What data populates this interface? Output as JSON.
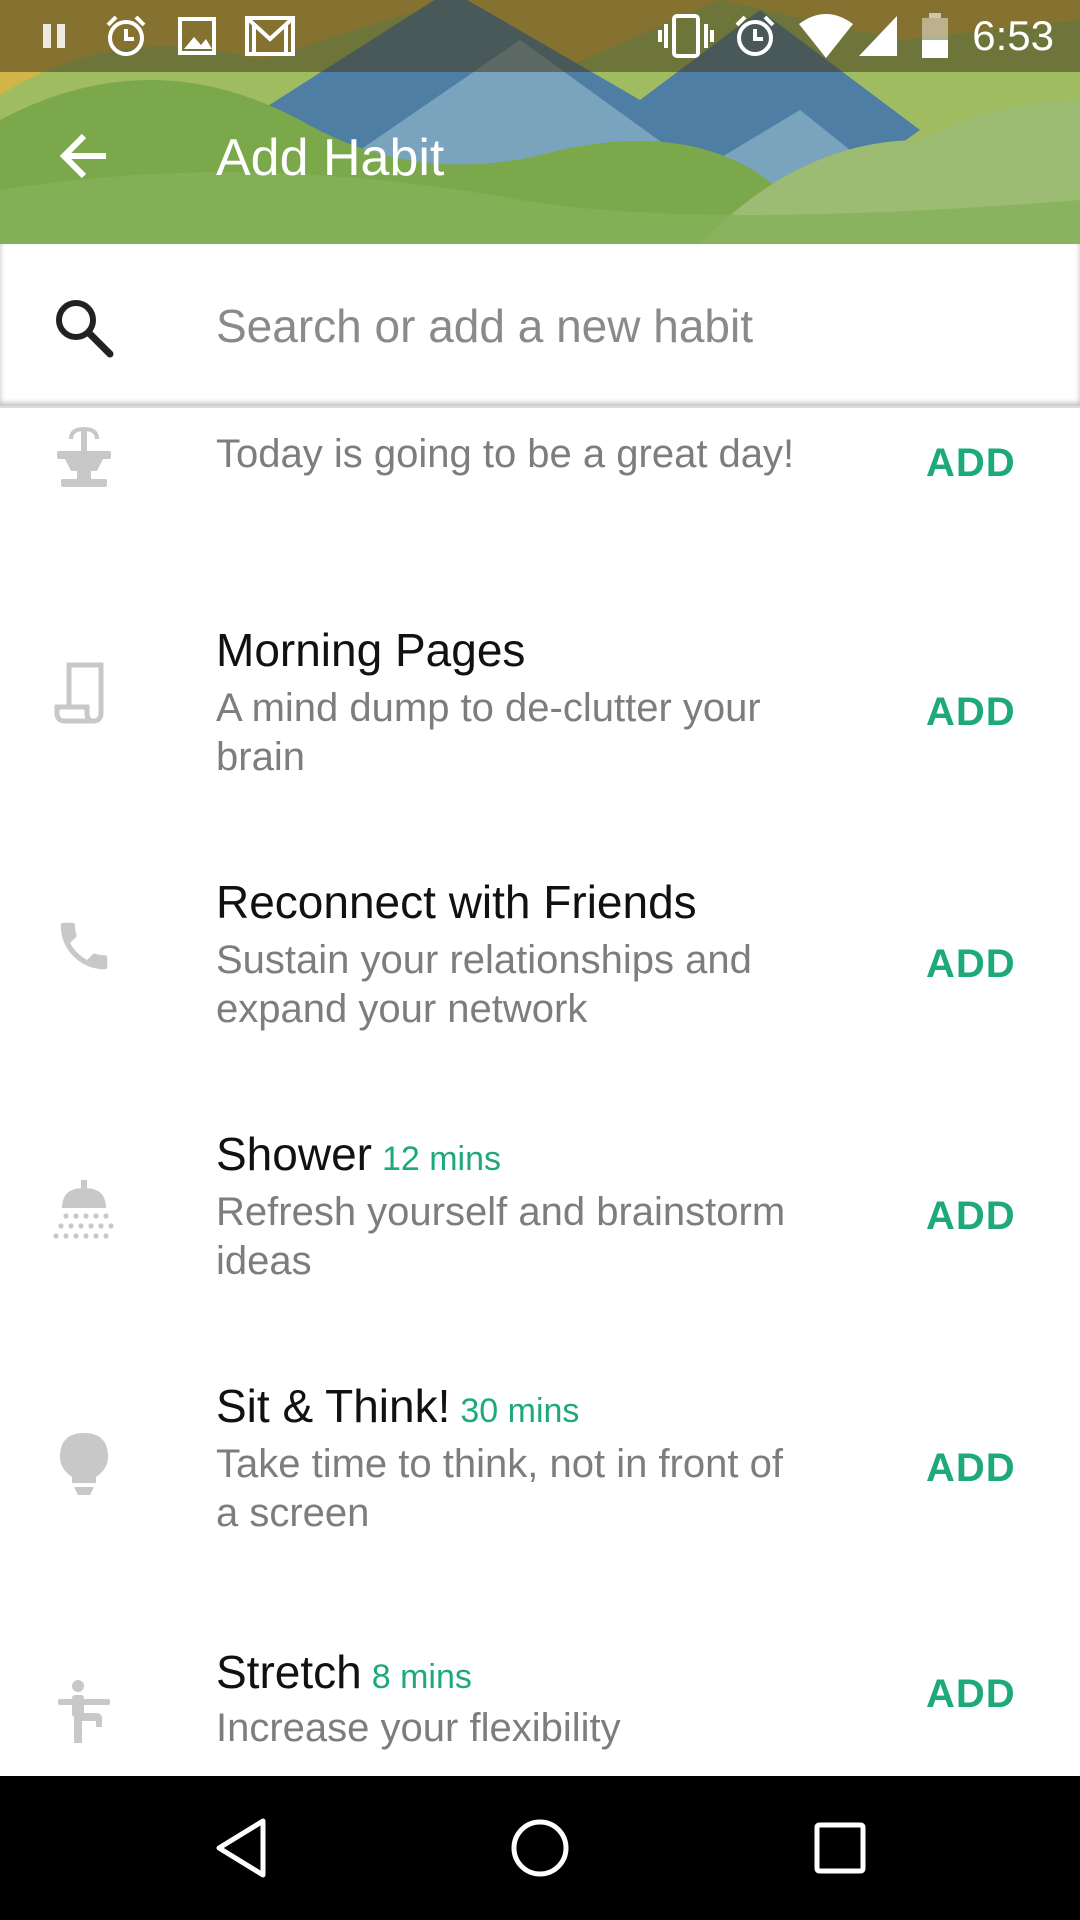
{
  "status_bar": {
    "time": "6:53",
    "left_icons": [
      "pause-icon",
      "alarm-icon",
      "image-icon",
      "gmail-icon"
    ],
    "right_icons": [
      "vibrate-icon",
      "alarm-icon",
      "wifi-icon",
      "signal-icon",
      "battery-icon"
    ]
  },
  "app_bar": {
    "title": "Add Habit"
  },
  "search": {
    "placeholder": "Search or add a new habit"
  },
  "colors": {
    "accent": "#1ea97c",
    "header_green": "#84b157",
    "text_secondary": "#7d7d7d"
  },
  "habits": [
    {
      "title": "",
      "duration": "",
      "description": "Today is going to be a great day!",
      "icon": "fountain-icon",
      "action": "ADD"
    },
    {
      "title": "Morning Pages",
      "duration": "",
      "description": "A mind dump to de-clutter your brain",
      "icon": "notepad-icon",
      "action": "ADD"
    },
    {
      "title": "Reconnect with Friends",
      "duration": "",
      "description": "Sustain your relationships and expand your network",
      "icon": "phone-icon",
      "action": "ADD"
    },
    {
      "title": "Shower",
      "duration": "12 mins",
      "description": "Refresh yourself and brainstorm ideas",
      "icon": "shower-icon",
      "action": "ADD"
    },
    {
      "title": "Sit & Think!",
      "duration": "30 mins",
      "description": "Take time to think, not in front of a screen",
      "icon": "lightbulb-icon",
      "action": "ADD"
    },
    {
      "title": "Stretch",
      "duration": "8 mins",
      "description": "Increase your flexibility",
      "icon": "stretch-icon",
      "action": "ADD"
    }
  ],
  "nav_bar": {
    "buttons": [
      "back-icon",
      "home-icon",
      "recents-icon"
    ]
  }
}
